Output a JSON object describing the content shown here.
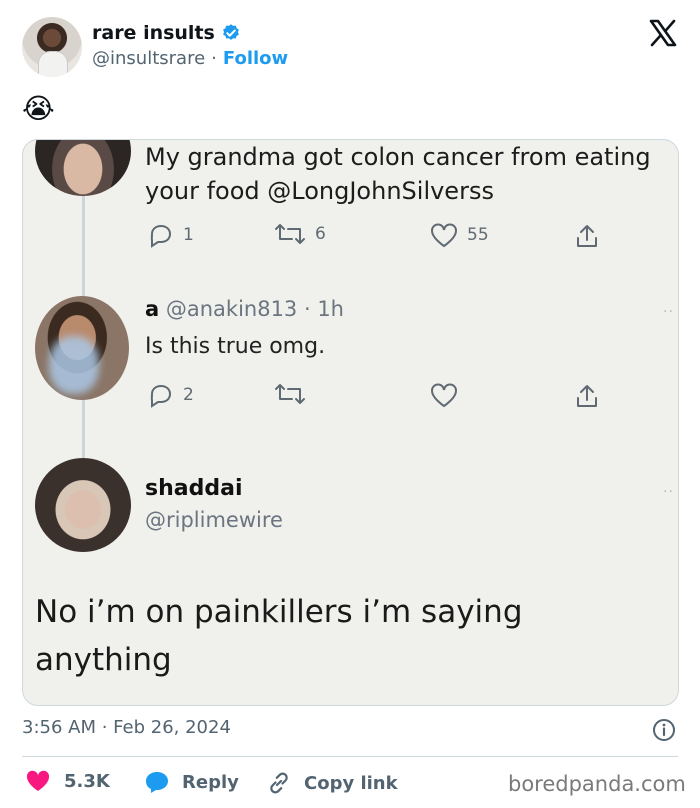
{
  "author": {
    "display_name": "rare insults",
    "handle": "@insultsrare",
    "separator": "·",
    "follow_label": "Follow"
  },
  "tweet_emoji": "😭",
  "embedded": {
    "tweet1": {
      "text": "My grandma got colon cancer from eating your food @LongJohnSilverss",
      "replies": "1",
      "retweets": "6",
      "likes": "55"
    },
    "tweet2": {
      "name": "a",
      "handle_time": "@anakin813 · 1h",
      "text": "Is this true omg.",
      "replies": "2"
    },
    "tweet3": {
      "name": "shaddai",
      "handle": "@riplimewire",
      "text": "No i’m on painkillers i’m saying anything"
    }
  },
  "footer": {
    "timestamp": "3:56 AM · Feb 26, 2024",
    "likes": "5.3K",
    "reply_label": "Reply",
    "copy_link_label": "Copy link",
    "watermark": "boredpanda.com"
  },
  "colors": {
    "accent": "#1d9bf0",
    "like": "#f91880",
    "muted": "#536471"
  },
  "icons": [
    "verified-badge-icon",
    "x-logo-icon",
    "reply-icon",
    "retweet-icon",
    "like-icon",
    "share-icon",
    "info-icon",
    "heart-icon",
    "speech-bubble-icon",
    "link-icon"
  ]
}
